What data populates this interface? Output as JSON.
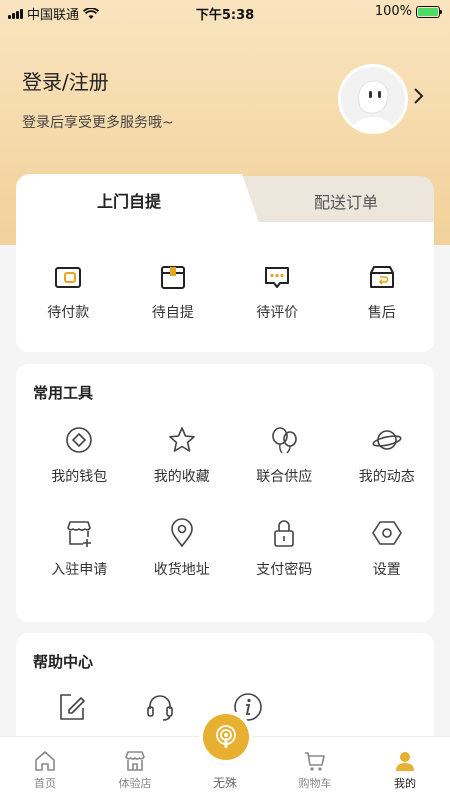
{
  "status_bar": {
    "carrier": "中国联通",
    "time": "下午5:38",
    "battery": "100%"
  },
  "profile": {
    "login_title": "登录/注册",
    "login_subtitle": "登录后享受更多服务哦~"
  },
  "order_tabs": {
    "active": "上门自提",
    "inactive": "配送订单"
  },
  "orders": [
    {
      "label": "待付款",
      "icon": "wallet-icon"
    },
    {
      "label": "待自提",
      "icon": "package-icon"
    },
    {
      "label": "待评价",
      "icon": "comment-icon"
    },
    {
      "label": "售后",
      "icon": "return-box-icon"
    }
  ],
  "tools": {
    "title": "常用工具",
    "items": [
      {
        "label": "我的钱包",
        "icon": "diamond-coin-icon"
      },
      {
        "label": "我的收藏",
        "icon": "star-icon"
      },
      {
        "label": "联合供应",
        "icon": "balloon-icon"
      },
      {
        "label": "我的动态",
        "icon": "planet-icon"
      },
      {
        "label": "入驻申请",
        "icon": "store-add-icon"
      },
      {
        "label": "收货地址",
        "icon": "location-pin-icon"
      },
      {
        "label": "支付密码",
        "icon": "lock-icon"
      },
      {
        "label": "设置",
        "icon": "hexagon-settings-icon"
      }
    ]
  },
  "help": {
    "title": "帮助中心",
    "items": [
      {
        "icon": "edit-icon"
      },
      {
        "icon": "headset-icon"
      },
      {
        "icon": "info-icon"
      }
    ]
  },
  "tabbar": {
    "items": [
      {
        "label": "首页",
        "icon": "home-icon"
      },
      {
        "label": "体验店",
        "icon": "shop-icon"
      },
      {
        "label": "无殊",
        "icon": "podcast-icon"
      },
      {
        "label": "购物车",
        "icon": "cart-icon"
      },
      {
        "label": "我的",
        "icon": "user-icon"
      }
    ],
    "active_index": 4
  },
  "colors": {
    "accent": "#e8b030",
    "header_gradient_top": "#f9e4bf",
    "header_gradient_bottom": "#f2d19a",
    "icon_accent": "#e8a51e"
  }
}
